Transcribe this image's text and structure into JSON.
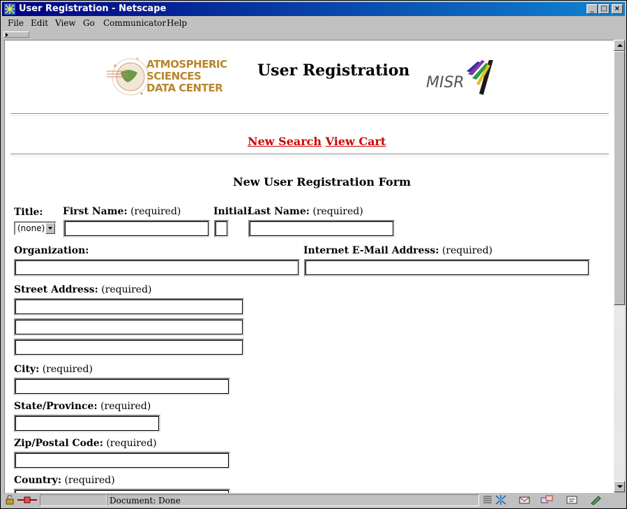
{
  "window": {
    "title": "User Registration - Netscape",
    "min": "_",
    "max": "□",
    "close": "×"
  },
  "menu": [
    "File",
    "Edit",
    "View",
    "Go",
    "Communicator",
    "Help"
  ],
  "page": {
    "asdc_logo_lines": [
      "ATMOSPHERIC",
      "SCIENCES",
      "DATA CENTER"
    ],
    "heading": "User Registration",
    "misr_logo": "MISR",
    "nav": {
      "new_search": "New Search",
      "view_cart": "View Cart"
    },
    "form_title": "New User Registration Form",
    "fields": {
      "title": {
        "label": "Title:",
        "value": "(none)"
      },
      "first_name": {
        "label": "First Name:",
        "note": "(required)",
        "value": ""
      },
      "initial": {
        "label": "Initial:",
        "value": ""
      },
      "last_name": {
        "label": "Last Name:",
        "note": "(required)",
        "value": ""
      },
      "organization": {
        "label": "Organization:",
        "value": ""
      },
      "email": {
        "label": "Internet E-Mail Address:",
        "note": "(required)",
        "value": ""
      },
      "street": {
        "label": "Street Address:",
        "note": "(required)",
        "values": [
          "",
          "",
          ""
        ]
      },
      "city": {
        "label": "City:",
        "note": "(required)",
        "value": ""
      },
      "state": {
        "label": "State/Province:",
        "note": "(required)",
        "value": ""
      },
      "zip": {
        "label": "Zip/Postal Code:",
        "note": "(required)",
        "value": ""
      },
      "country": {
        "label": "Country:",
        "note": "(required)",
        "value": ""
      }
    }
  },
  "status": {
    "text": "Document: Done"
  }
}
